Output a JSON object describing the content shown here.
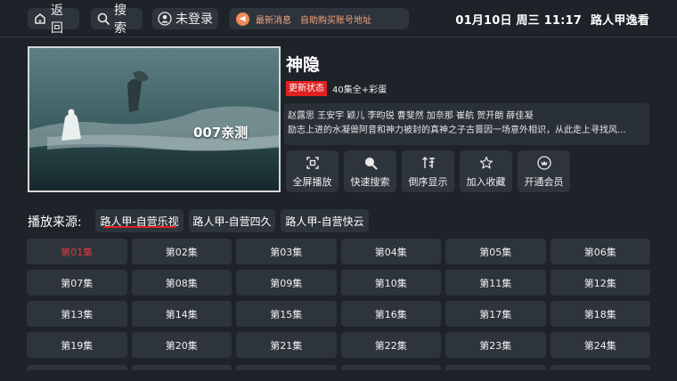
{
  "topbar": {
    "back_label": "返回",
    "search_label": "搜索",
    "login_label": "未登录",
    "news_label": "最新消息",
    "news_text": "自助购买账号地址",
    "clock": "01月10日 周三 11:17",
    "brand": "路人甲逸看"
  },
  "poster": {
    "caption": "007亲测"
  },
  "detail": {
    "title": "神隐",
    "status_badge": "更新状态",
    "episode_info": "40集全+彩蛋",
    "cast": "赵露思 王安宇 颖儿 李昀锐 曹斐然 加奈那 崔航 贺开朗 薛佳凝",
    "synopsis": "励志上进的水凝兽阿音和神力被封的真神之子古晋因一场意外相识，从此走上寻找风..."
  },
  "actions": [
    {
      "label": "全屏播放",
      "icon": "fullscreen-icon"
    },
    {
      "label": "快速搜索",
      "icon": "search-icon"
    },
    {
      "label": "倒序显示",
      "icon": "sort-icon"
    },
    {
      "label": "加入收藏",
      "icon": "star-icon"
    },
    {
      "label": "开通会员",
      "icon": "vip-icon"
    }
  ],
  "sources": {
    "label": "播放来源:",
    "tabs": [
      "路人甲-自营乐视",
      "路人甲-自营四久",
      "路人甲-自营快云"
    ],
    "active_index": 0
  },
  "episodes": [
    "第01集",
    "第02集",
    "第03集",
    "第04集",
    "第05集",
    "第06集",
    "第07集",
    "第08集",
    "第09集",
    "第10集",
    "第11集",
    "第12集",
    "第13集",
    "第14集",
    "第15集",
    "第16集",
    "第17集",
    "第18集",
    "第19集",
    "第20集",
    "第21集",
    "第22集",
    "第23集",
    "第24集"
  ],
  "current_episode_index": 0,
  "colors": {
    "background": "#1e2329",
    "button": "#2e343c",
    "accent_red": "#e02020",
    "news_orange": "#f2a37f"
  }
}
